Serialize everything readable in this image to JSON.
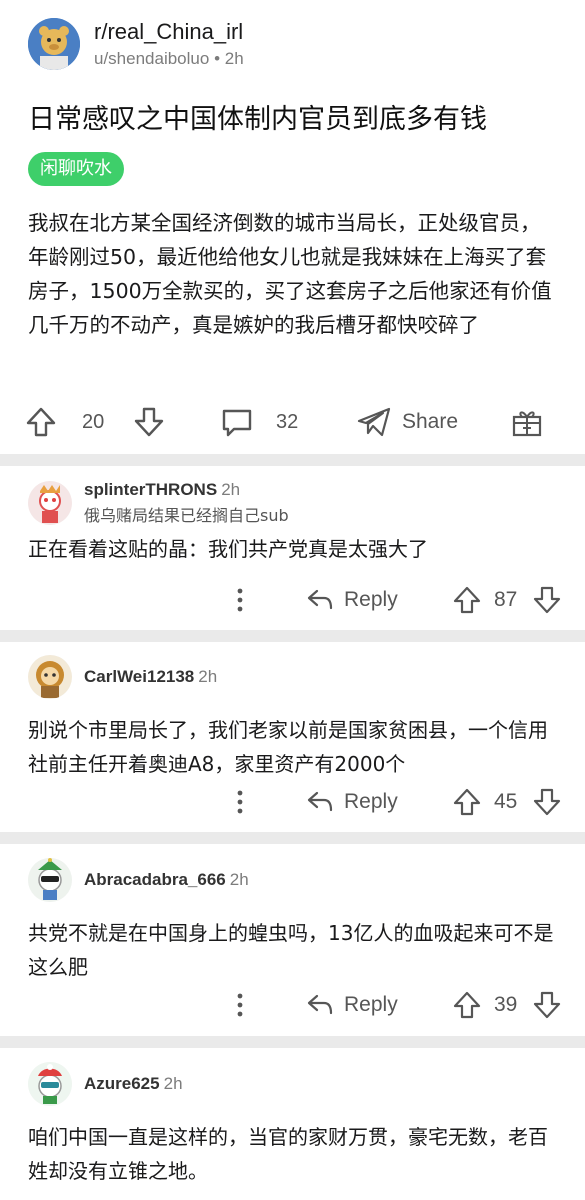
{
  "post": {
    "subreddit": "r/real_China_irl",
    "author": "u/shendaiboluo",
    "time": "2h",
    "title": "日常感叹之中国体制内官员到底多有钱",
    "flair": "闲聊吹水",
    "body": "我叔在北方某全国经济倒数的城市当局长，正处级官员，年龄刚过50，最近他给他女儿也就是我妹妹在上海买了套房子，1500万全款买的，买了这套房子之后他家还有价值几千万的不动产，真是嫉妒的我后槽牙都快咬碎了",
    "votes": "20",
    "comments": "32",
    "share_label": "Share",
    "separator": "•"
  },
  "comments": [
    {
      "user": "splinterTHRONS",
      "time": "2h",
      "flair": "俄乌赌局结果已经搁自己sub",
      "body": "正在看着这贴的晶：我们共产党真是太强大了",
      "reply_label": "Reply",
      "score": "87"
    },
    {
      "user": "CarlWei12138",
      "time": "2h",
      "flair": "",
      "body": "别说个市里局长了，我们老家以前是国家贫困县，一个信用社前主任开着奥迪A8，家里资产有2000个",
      "reply_label": "Reply",
      "score": "45"
    },
    {
      "user": "Abracadabra_666",
      "time": "2h",
      "flair": "",
      "body": "共党不就是在中国身上的蝗虫吗，13亿人的血吸起来可不是这么肥",
      "reply_label": "Reply",
      "score": "39"
    },
    {
      "user": "Azure625",
      "time": "2h",
      "flair": "",
      "body": "咱们中国一直是这样的，当官的家财万贯，豪宅无数，老百姓却没有立锥之地。",
      "reply_label": "",
      "score": ""
    }
  ],
  "colors": {
    "flair_bg": "#3ecf6a",
    "divider": "#eaeaea",
    "muted": "#7c7c7c",
    "icon": "#565656"
  },
  "icons": [
    "upvote-icon",
    "downvote-icon",
    "comment-icon",
    "share-icon",
    "gift-icon",
    "more-icon",
    "reply-icon"
  ]
}
